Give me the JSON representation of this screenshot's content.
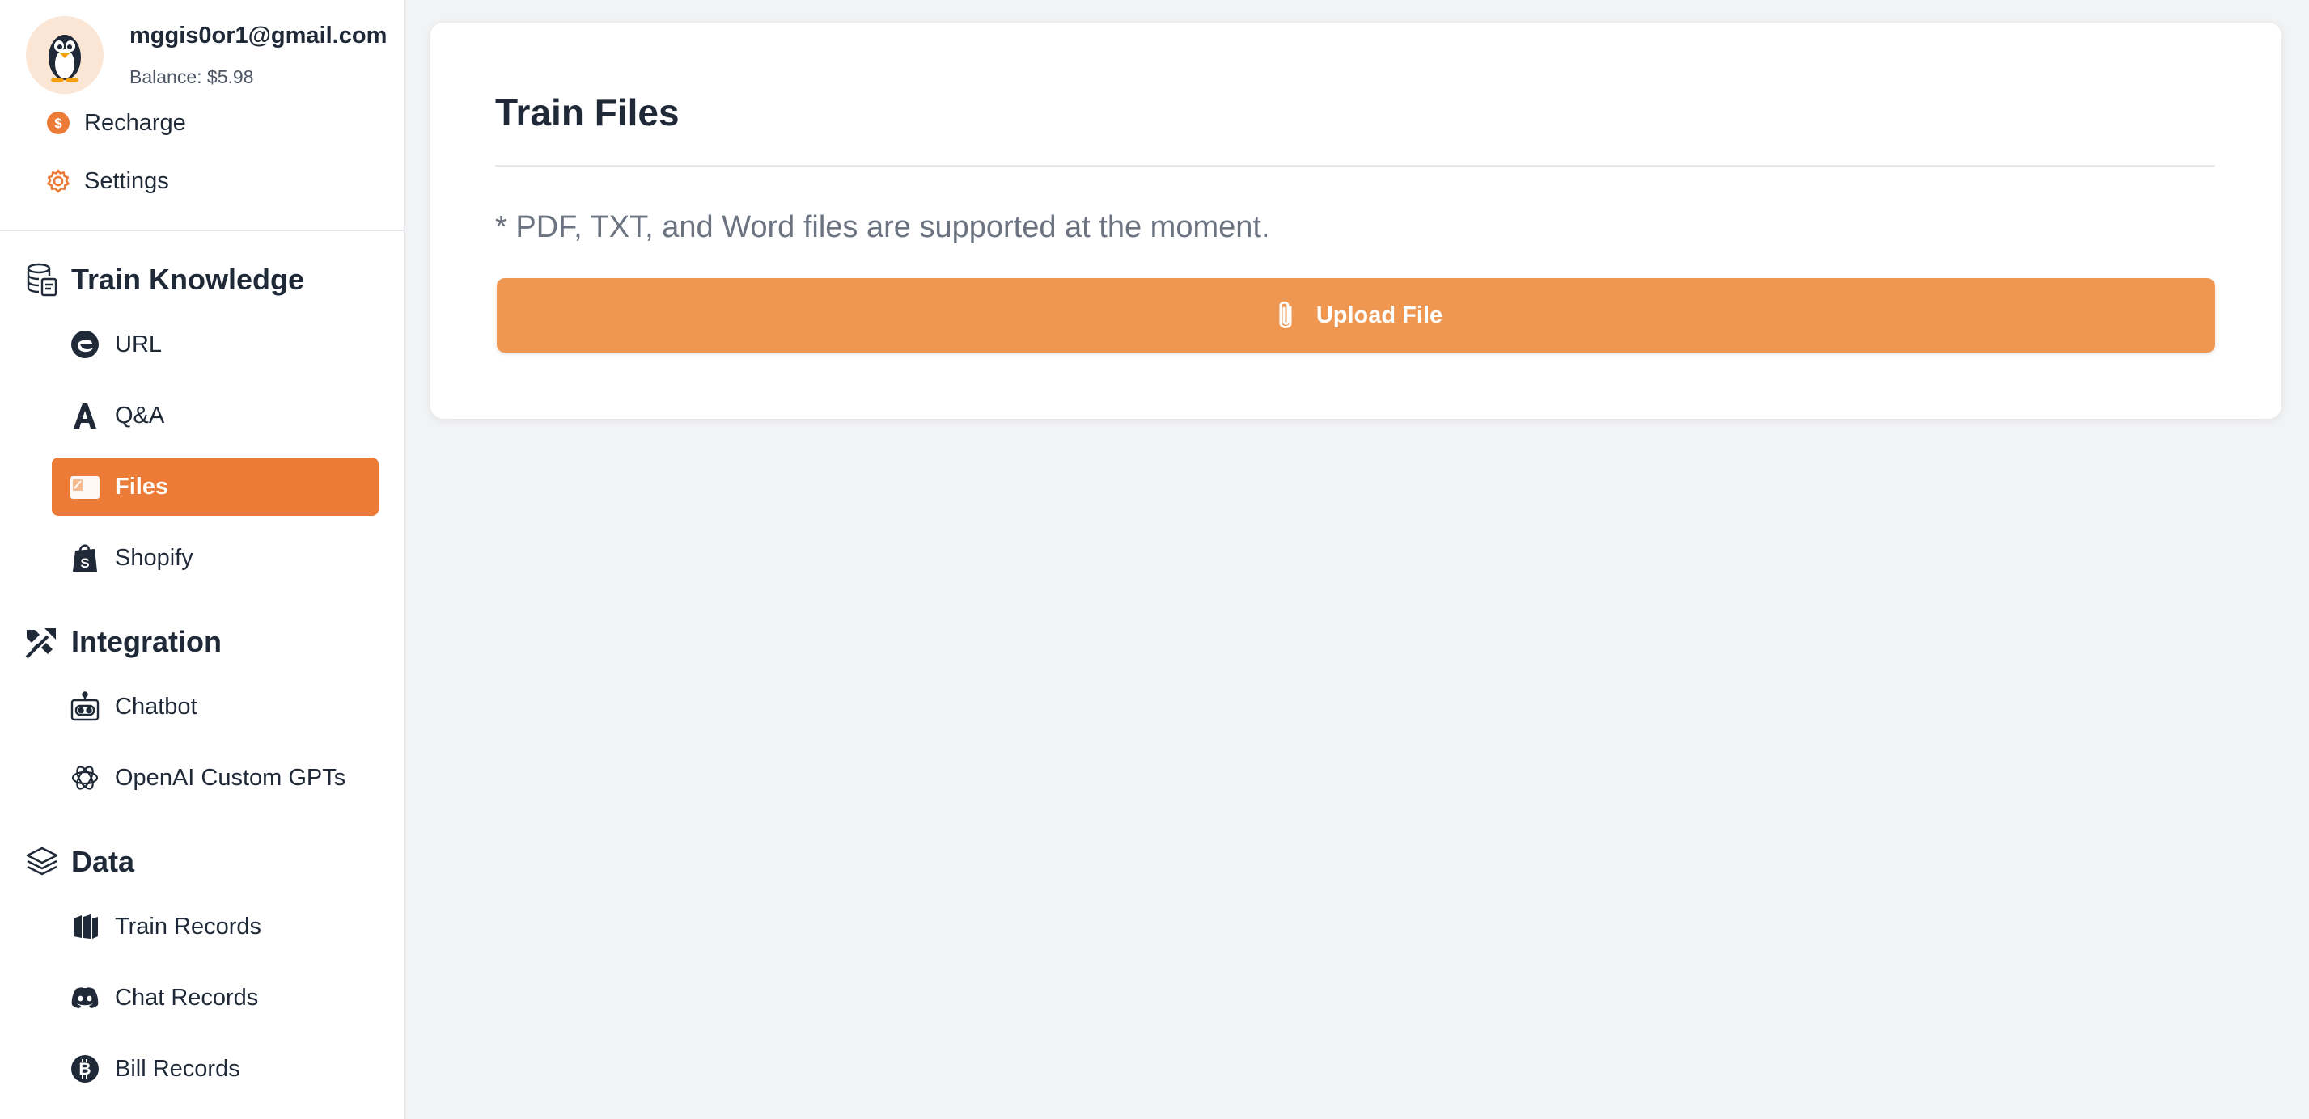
{
  "user": {
    "email": "mggis0or1@gmail.com",
    "balance": "Balance: $5.98",
    "avatar_icon": "penguin-avatar-icon"
  },
  "account_links": [
    {
      "label": "Recharge",
      "icon": "dollar-circle-icon"
    },
    {
      "label": "Settings",
      "icon": "gear-icon"
    }
  ],
  "sections": {
    "train_knowledge": {
      "title": "Train Knowledge",
      "icon": "database-icon",
      "items": [
        {
          "label": "URL",
          "icon": "edge-browser-icon"
        },
        {
          "label": "Q&A",
          "icon": "letter-a-icon"
        },
        {
          "label": "Files",
          "icon": "files-icon",
          "active": true
        },
        {
          "label": "Shopify",
          "icon": "shopify-bag-icon"
        }
      ]
    },
    "integration": {
      "title": "Integration",
      "icon": "integration-icon",
      "items": [
        {
          "label": "Chatbot",
          "icon": "robot-icon"
        },
        {
          "label": "OpenAI Custom GPTs",
          "icon": "openai-icon"
        }
      ]
    },
    "data": {
      "title": "Data",
      "icon": "layers-icon",
      "items": [
        {
          "label": "Train Records",
          "icon": "train-records-icon"
        },
        {
          "label": "Chat Records",
          "icon": "discord-icon"
        },
        {
          "label": "Bill Records",
          "icon": "bitcoin-icon"
        }
      ]
    }
  },
  "main": {
    "title": "Train Files",
    "note": "* PDF, TXT, and Word files are supported at the moment.",
    "upload_label": "Upload File",
    "upload_icon": "paperclip-icon"
  },
  "colors": {
    "accent": "#ec7b37",
    "upload_button": "#ef9650",
    "background": "#f2f3f5",
    "text": "#1f2937",
    "muted": "#6b7280"
  }
}
